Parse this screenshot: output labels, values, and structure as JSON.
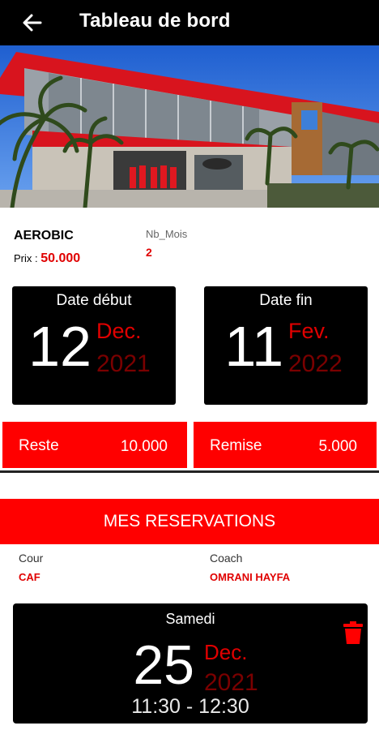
{
  "appbar": {
    "title": "Tableau de bord",
    "back_icon": "arrow-left-icon"
  },
  "hero": {
    "image": "fitness club building facade"
  },
  "subscription": {
    "course": "AEROBIC",
    "price_label": "Prix : ",
    "price_value": "50.000",
    "months_label": "Nb_Mois",
    "months_value": "2"
  },
  "date_start": {
    "title": "Date début",
    "day": "12",
    "month": "Dec.",
    "year": "2021"
  },
  "date_end": {
    "title": "Date fin",
    "day": "11",
    "month": "Fev.",
    "year": "2022"
  },
  "balance": {
    "rest_label": "Reste",
    "rest_value": "10.000",
    "discount_label": "Remise",
    "discount_value": "5.000"
  },
  "reservations": {
    "header": "MES RESERVATIONS",
    "course_label": "Cour",
    "course_value": "CAF",
    "coach_label": "Coach",
    "coach_value": "OMRANI HAYFA",
    "items": [
      {
        "weekday": "Samedi",
        "day": "25",
        "month": "Dec.",
        "year": "2021",
        "time": "11:30 - 12:30",
        "delete_icon": "trash-icon"
      }
    ]
  },
  "colors": {
    "accent": "#ff0000",
    "dark": "#000000",
    "dim_red": "#7a0000"
  }
}
